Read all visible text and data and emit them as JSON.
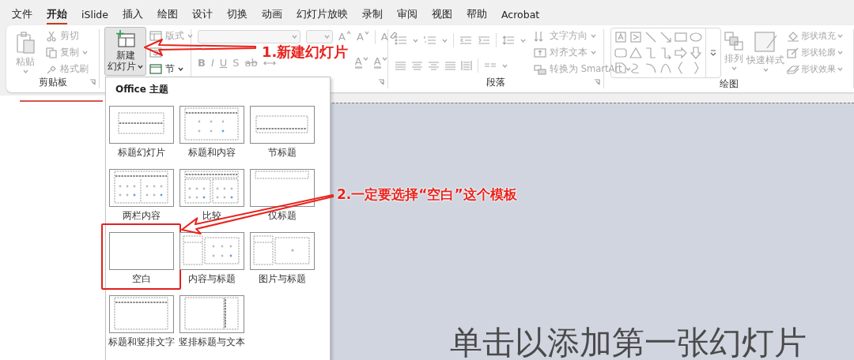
{
  "tabs": [
    {
      "label": "文件",
      "selected": false
    },
    {
      "label": "开始",
      "selected": true
    },
    {
      "label": "iSlide",
      "selected": false
    },
    {
      "label": "插入",
      "selected": false
    },
    {
      "label": "绘图",
      "selected": false
    },
    {
      "label": "设计",
      "selected": false
    },
    {
      "label": "切换",
      "selected": false
    },
    {
      "label": "动画",
      "selected": false
    },
    {
      "label": "幻灯片放映",
      "selected": false
    },
    {
      "label": "录制",
      "selected": false
    },
    {
      "label": "审阅",
      "selected": false
    },
    {
      "label": "视图",
      "selected": false
    },
    {
      "label": "帮助",
      "selected": false
    },
    {
      "label": "Acrobat",
      "selected": false
    }
  ],
  "ribbon": {
    "groups": [
      {
        "label": "剪贴板",
        "items": [
          {
            "label": "粘贴",
            "disabled": true
          },
          {
            "label": "剪切",
            "disabled": true
          },
          {
            "label": "复制",
            "disabled": true
          },
          {
            "label": "格式刷",
            "disabled": true
          }
        ]
      },
      {
        "items": [
          {
            "label_lines": [
              "新建",
              "幻灯片"
            ],
            "disabled": false,
            "pressed": true
          },
          {
            "label": "版式",
            "disabled": true
          },
          {
            "label": "节",
            "disabled": false
          }
        ]
      },
      {
        "items": [
          {
            "kind": "grow",
            "label": "A"
          },
          {
            "kind": "shrink",
            "label": "A"
          },
          {
            "kind": "clear",
            "label": "A"
          },
          {
            "kind": "bold",
            "label": "B"
          },
          {
            "kind": "italic",
            "label": "I"
          },
          {
            "kind": "underline",
            "label": "U"
          },
          {
            "kind": "shadow",
            "label": "S"
          },
          {
            "kind": "strike",
            "label": "ab"
          },
          {
            "kind": "highlight",
            "label": "A"
          },
          {
            "kind": "color",
            "label": "A"
          }
        ]
      },
      {
        "label": "段落",
        "items": [
          {
            "label": "文字方向",
            "disabled": true
          },
          {
            "label": "对齐文本",
            "disabled": true
          },
          {
            "label": "转换为 SmartArt",
            "disabled": true
          }
        ]
      },
      {
        "label": "绘图",
        "items": [
          {
            "label": "排列",
            "disabled": true
          },
          {
            "label": "快速样式",
            "disabled": true
          },
          {
            "label": "形状填充",
            "disabled": true
          },
          {
            "label": "形状轮廓",
            "disabled": true
          },
          {
            "label": "形状效果",
            "disabled": true
          }
        ]
      }
    ]
  },
  "layout_menu": {
    "title": "Office 主题",
    "layouts": [
      {
        "label": "标题幻灯片",
        "kind": "title",
        "highlighted": false
      },
      {
        "label": "标题和内容",
        "kind": "title_content",
        "highlighted": false
      },
      {
        "label": "节标题",
        "kind": "section",
        "highlighted": false
      },
      {
        "label": "两栏内容",
        "kind": "two_content",
        "highlighted": false
      },
      {
        "label": "比较",
        "kind": "comparison",
        "highlighted": false
      },
      {
        "label": "仅标题",
        "kind": "title_only",
        "highlighted": false
      },
      {
        "label": "空白",
        "kind": "blank",
        "highlighted": true
      },
      {
        "label": "内容与标题",
        "kind": "content_caption",
        "highlighted": false
      },
      {
        "label": "图片与标题",
        "kind": "picture_caption",
        "highlighted": false
      },
      {
        "label": "标题和竖排文字",
        "kind": "title_vertical",
        "highlighted": false
      },
      {
        "label": "竖排标题与文本",
        "kind": "vertical_title",
        "highlighted": false
      }
    ]
  },
  "slide": {
    "placeholder": "单击以添加第一张幻灯片"
  },
  "annotations": [
    {
      "kind": "arrow",
      "text": "1.新建幻灯片"
    },
    {
      "kind": "arrow",
      "text": "2.一定要选择“空白”这个模板"
    }
  ]
}
